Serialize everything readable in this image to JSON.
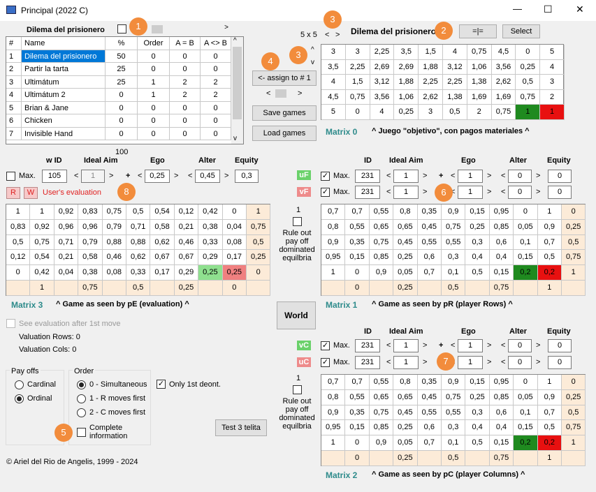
{
  "window": {
    "title": "Principal (2022 C)",
    "minimize": "—",
    "maximize": "☐",
    "close": "✕"
  },
  "games": {
    "label": "Dilema del prisionero",
    "headers": [
      "#",
      "Name",
      "%",
      "Order",
      "A = B",
      "A <> B"
    ],
    "rows": [
      [
        "1",
        "Dilema del prisionero",
        "50",
        "0",
        "0",
        "0"
      ],
      [
        "2",
        "Partir la tarta",
        "25",
        "0",
        "0",
        "0"
      ],
      [
        "3",
        "Ultimátum",
        "25",
        "1",
        "2",
        "2"
      ],
      [
        "4",
        "Ultimátum 2",
        "0",
        "1",
        "2",
        "2"
      ],
      [
        "5",
        "Brian & Jane",
        "0",
        "0",
        "0",
        "0"
      ],
      [
        "6",
        "Chicken",
        "0",
        "0",
        "0",
        "0"
      ],
      [
        "7",
        "Invisible Hand",
        "0",
        "0",
        "0",
        "0"
      ]
    ]
  },
  "top": {
    "size": "5 x 5",
    "game_title": "Dilema del prisionero",
    "eq_button": "=|=",
    "select_button": "Select",
    "assign_button": "<- assign to # 1",
    "save_button": "Save games",
    "load_button": "Load games",
    "world_button": "World",
    "test_button": "Test 3 telita"
  },
  "markers": [
    "1",
    "2",
    "3",
    "3",
    "4",
    "5",
    "6",
    "7",
    "8"
  ],
  "m0": {
    "label": "Matrix 0",
    "caption": "^ Juego \"objetivo\", con pagos materiales ^",
    "rows": [
      [
        "3",
        "3",
        "2,25",
        "3,5",
        "1,5",
        "4",
        "0,75",
        "4,5",
        "0",
        "5"
      ],
      [
        "3,5",
        "2,25",
        "2,69",
        "2,69",
        "1,88",
        "3,12",
        "1,06",
        "3,56",
        "0,25",
        "4"
      ],
      [
        "4",
        "1,5",
        "3,12",
        "1,88",
        "2,25",
        "2,25",
        "1,38",
        "2,62",
        "0,5",
        "3"
      ],
      [
        "4,5",
        "0,75",
        "3,56",
        "1,06",
        "2,62",
        "1,38",
        "1,69",
        "1,69",
        "0,75",
        "2"
      ],
      [
        "5",
        "0",
        "4",
        "0,25",
        "3",
        "0,5",
        "2",
        "0,75",
        "1",
        "1"
      ]
    ]
  },
  "eval": {
    "top_num": "100",
    "max": "Max.",
    "id_label": "w ID",
    "ideal": "Ideal Aim",
    "ego": "Ego",
    "alter": "Alter",
    "equity": "Equity",
    "id": "105",
    "ideal_val": "1",
    "ego_val": "0,25",
    "alter_val": "0,45",
    "equity_val": "0,3",
    "r": "R",
    "w": "W",
    "users_eval": "User's evaluation"
  },
  "m3": {
    "label": "Matrix 3",
    "caption": "^ Game as seen by pE (evaluation) ^",
    "rows": [
      [
        "1",
        "1",
        "0,92",
        "0,83",
        "0,75",
        "0,5",
        "0,54",
        "0,12",
        "0,42",
        "0",
        "1"
      ],
      [
        "0,83",
        "0,92",
        "0,96",
        "0,96",
        "0,79",
        "0,71",
        "0,58",
        "0,21",
        "0,38",
        "0,04",
        "0,75"
      ],
      [
        "0,5",
        "0,75",
        "0,71",
        "0,79",
        "0,88",
        "0,88",
        "0,62",
        "0,46",
        "0,33",
        "0,08",
        "0,5"
      ],
      [
        "0,12",
        "0,54",
        "0,21",
        "0,58",
        "0,46",
        "0,62",
        "0,67",
        "0,67",
        "0,29",
        "0,17",
        "0,25"
      ],
      [
        "0",
        "0,42",
        "0,04",
        "0,38",
        "0,08",
        "0,33",
        "0,17",
        "0,29",
        "0,25",
        "0,25",
        "0"
      ],
      [
        "",
        "1",
        "",
        "0,75",
        "",
        "0,5",
        "",
        "0,25",
        "",
        "0",
        ""
      ]
    ]
  },
  "mid": {
    "one": "1",
    "ruleout": "Rule out pay off dominated equilbria"
  },
  "pr": {
    "id_label": "ID",
    "ideal": "Ideal Aim",
    "ego": "Ego",
    "alter": "Alter",
    "equity": "Equity",
    "tag1": "uF",
    "tag2": "vF",
    "max": "Max.",
    "id1": "231",
    "id2": "231",
    "ideal1": "1",
    "ideal2": "1",
    "ego1": "1",
    "ego2": "1",
    "alter1": "0",
    "alter2": "0",
    "eq1": "0",
    "eq2": "0"
  },
  "m1": {
    "label": "Matrix 1",
    "caption": "^ Game as seen by pR (player Rows) ^",
    "rows": [
      [
        "0,7",
        "0,7",
        "0,55",
        "0,8",
        "0,35",
        "0,9",
        "0,15",
        "0,95",
        "0",
        "1",
        "0"
      ],
      [
        "0,8",
        "0,55",
        "0,65",
        "0,65",
        "0,45",
        "0,75",
        "0,25",
        "0,85",
        "0,05",
        "0,9",
        "0,25"
      ],
      [
        "0,9",
        "0,35",
        "0,75",
        "0,45",
        "0,55",
        "0,55",
        "0,3",
        "0,6",
        "0,1",
        "0,7",
        "0,5"
      ],
      [
        "0,95",
        "0,15",
        "0,85",
        "0,25",
        "0,6",
        "0,3",
        "0,4",
        "0,4",
        "0,15",
        "0,5",
        "0,75"
      ],
      [
        "1",
        "0",
        "0,9",
        "0,05",
        "0,7",
        "0,1",
        "0,5",
        "0,15",
        "0,2",
        "0,2",
        "1"
      ],
      [
        "",
        "0",
        "",
        "0,25",
        "",
        "0,5",
        "",
        "0,75",
        "",
        "1",
        ""
      ]
    ]
  },
  "pc": {
    "tag1": "vC",
    "tag2": "uC",
    "max": "Max.",
    "id1": "231",
    "id2": "231",
    "ideal1": "1",
    "ideal2": "1",
    "ego1": "1",
    "ego2": "1",
    "alter1": "0",
    "alter2": "0",
    "eq1": "0",
    "eq2": "0"
  },
  "m2": {
    "label": "Matrix 2",
    "caption": "^ Game as seen by pC (player Columns) ^",
    "rows": [
      [
        "0,7",
        "0,7",
        "0,55",
        "0,8",
        "0,35",
        "0,9",
        "0,15",
        "0,95",
        "0",
        "1",
        "0"
      ],
      [
        "0,8",
        "0,55",
        "0,65",
        "0,65",
        "0,45",
        "0,75",
        "0,25",
        "0,85",
        "0,05",
        "0,9",
        "0,25"
      ],
      [
        "0,9",
        "0,35",
        "0,75",
        "0,45",
        "0,55",
        "0,55",
        "0,3",
        "0,6",
        "0,1",
        "0,7",
        "0,5"
      ],
      [
        "0,95",
        "0,15",
        "0,85",
        "0,25",
        "0,6",
        "0,3",
        "0,4",
        "0,4",
        "0,15",
        "0,5",
        "0,75"
      ],
      [
        "1",
        "0",
        "0,9",
        "0,05",
        "0,7",
        "0,1",
        "0,5",
        "0,15",
        "0,2",
        "0,2",
        "1"
      ],
      [
        "",
        "0",
        "",
        "0,25",
        "",
        "0,5",
        "",
        "0,75",
        "",
        "1",
        ""
      ]
    ]
  },
  "left": {
    "see_eval": "See evaluation after 1st move",
    "val_rows": "Valuation Rows: 0",
    "val_cols": "Valuation Cols: 0",
    "payoffs": "Pay offs",
    "cardinal": "Cardinal",
    "ordinal": "Ordinal",
    "order": "Order",
    "o0": "0 - Simultaneous",
    "o1": "1 - R moves first",
    "o2": "2 - C moves first",
    "only1": "Only 1st deont.",
    "complete": "Complete information",
    "copyright": "© Ariel del Rio de Angelis, 1999 - 2024"
  },
  "colors": {
    "green": "#1f8a1f",
    "red": "#e81010",
    "peach": "#fcebd8",
    "accent": "#f28c3c",
    "teal": "#2e8b8b"
  }
}
